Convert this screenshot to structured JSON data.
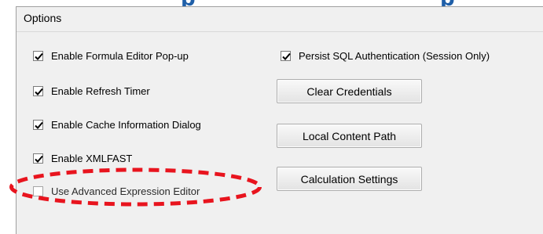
{
  "banner": {
    "cut_text_left": "p",
    "cut_text_right": "p"
  },
  "options_group": {
    "title": "Options"
  },
  "checkboxes": [
    {
      "label": "Enable Formula Editor Pop-up",
      "checked": true
    },
    {
      "label": "Enable Refresh Timer",
      "checked": true
    },
    {
      "label": "Enable Cache Information Dialog",
      "checked": true
    },
    {
      "label": "Enable XMLFAST",
      "checked": true
    },
    {
      "label": "Use Advanced Expression Editor",
      "checked": false
    },
    {
      "label": "Persist SQL Authentication (Session Only)",
      "checked": true
    }
  ],
  "buttons": {
    "clear_credentials": "Clear Credentials",
    "local_content_path": "Local Content Path",
    "calculation_settings": "Calculation Settings"
  },
  "colors": {
    "highlight": "#e8141e",
    "panel_background": "#f0f0f0",
    "heading_accent": "#1f5fa8"
  },
  "icons": {
    "check": "check-mark-icon"
  }
}
